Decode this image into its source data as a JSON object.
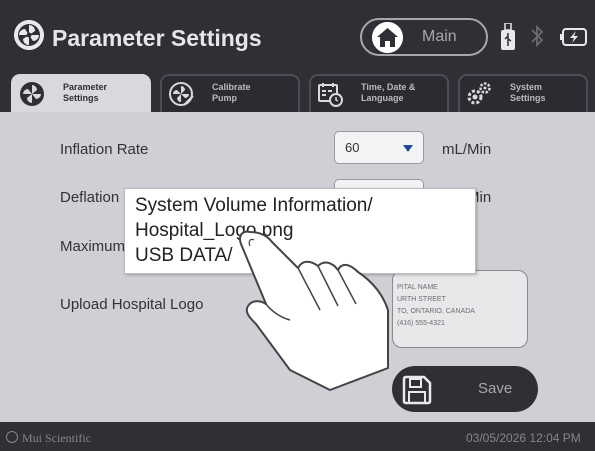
{
  "header": {
    "title": "Parameter Settings",
    "main_button_label": "Main"
  },
  "tabs": [
    {
      "line1": "Parameter",
      "line2": "Settings",
      "active": true
    },
    {
      "line1": "Calibrate",
      "line2": "Pump",
      "active": false
    },
    {
      "line1": "Time, Date &",
      "line2": "Language",
      "active": false
    },
    {
      "line1": "System",
      "line2": "Settings",
      "active": false
    }
  ],
  "settings": {
    "inflation": {
      "label": "Inflation Rate",
      "value": "60",
      "unit": "mL/Min"
    },
    "deflation": {
      "label": "Deflation R",
      "unit": "mL/Min"
    },
    "maximum": {
      "label": "Maximum"
    },
    "upload_logo": {
      "label": "Upload Hospital Logo"
    }
  },
  "logo_preview": {
    "line1": "PITAL NAME",
    "line2": "URTH STREET",
    "line3": "TO, ONTARIO, CANADA",
    "line4": "(416) 555-4321"
  },
  "save_button_label": "Save",
  "file_popup": {
    "items": [
      "System Volume Information/",
      "Hospital_Logo.png",
      "USB DATA/"
    ]
  },
  "footer": {
    "brand": "Mui Scientific",
    "datetime": "03/05/2026 12:04 PM"
  }
}
